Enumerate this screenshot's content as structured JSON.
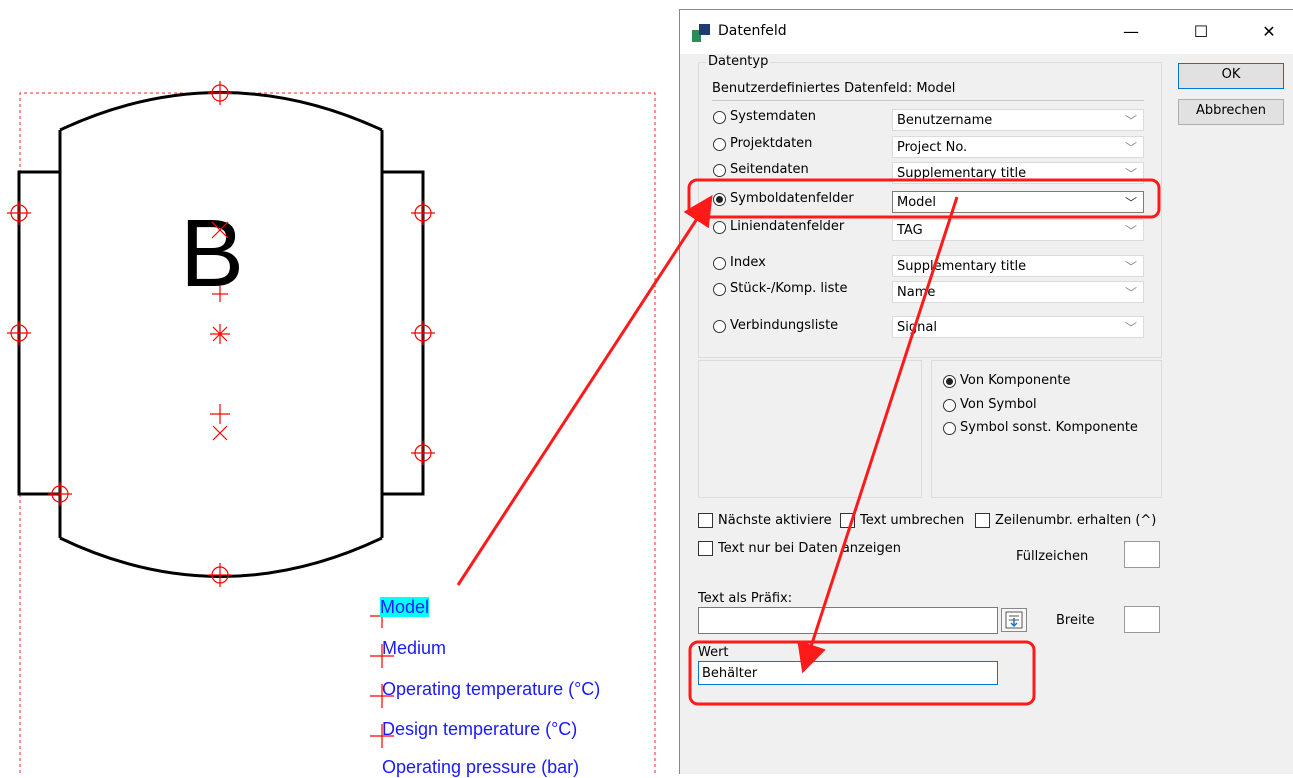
{
  "drawing": {
    "symbol_letter": "B",
    "labels": [
      "Model",
      "Medium",
      "Operating temperature (°C)",
      "Design temperature (°C)",
      "Operating pressure (bar)"
    ]
  },
  "dialog": {
    "title": "Datenfeld",
    "window_buttons": {
      "minimize": "—",
      "maximize": "☐",
      "close": "✕"
    },
    "ok_label": "OK",
    "cancel_label": "Abbrechen",
    "datatype_group_label": "Datentyp",
    "custom_field_label": "Benutzerdefiniertes Datenfeld: Model",
    "rows": [
      {
        "label": "Systemdaten",
        "value": "Benutzername",
        "selected": false
      },
      {
        "label": "Projektdaten",
        "value": "Project No.",
        "selected": false
      },
      {
        "label": "Seitendaten",
        "value": "Supplementary title",
        "selected": false
      },
      {
        "label": "Symboldatenfelder",
        "value": "Model",
        "selected": true
      },
      {
        "label": "Liniendatenfelder",
        "value": "TAG",
        "selected": false
      },
      {
        "label": "Index",
        "value": "Supplementary title",
        "selected": false
      },
      {
        "label": "Stück-/Komp. liste",
        "value": "Name",
        "selected": false
      },
      {
        "label": "Verbindungsliste",
        "value": "Signal",
        "selected": false
      }
    ],
    "source_options": [
      {
        "label": "Von Komponente",
        "selected": true
      },
      {
        "label": "Von Symbol",
        "selected": false
      },
      {
        "label": "Symbol sonst. Komponente",
        "selected": false
      }
    ],
    "checkboxes": {
      "next_activate": "Nächste aktiviere",
      "wrap_text": "Text umbrechen",
      "keep_linebreak": "Zeilenumbr. erhalten (^)",
      "text_only_data": "Text nur bei Daten anzeigen"
    },
    "fill_char_label": "Füllzeichen",
    "prefix_label": "Text als Präfix:",
    "width_label": "Breite",
    "value_label": "Wert",
    "value": "Behälter"
  },
  "colors": {
    "highlight": "#ff1a1a",
    "cad_red": "#ff0000",
    "label_blue": "#1a1aff",
    "label_highlight": "#00ffff"
  }
}
